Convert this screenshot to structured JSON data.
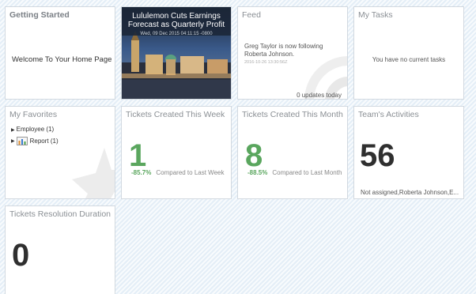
{
  "getting_started": {
    "title": "Getting Started",
    "welcome": "Welcome To Your Home Page"
  },
  "news": {
    "headline": "Lululemon Cuts Earnings Forecast as Quarterly Profit",
    "date": "Wed, 09 Dec 2015 04:11:15 -0800"
  },
  "feed": {
    "title": "Feed",
    "message": "Greg Taylor is now following Roberta Johnson.",
    "timestamp": "2016-10-26 13:30:56Z",
    "updates": "0 updates today"
  },
  "tasks": {
    "title": "My Tasks",
    "empty": "You have no current tasks"
  },
  "favorites": {
    "title": "My Favorites",
    "items": [
      {
        "label": "Employee (1)"
      },
      {
        "label": "Report (1)"
      }
    ]
  },
  "tickets_week": {
    "title": "Tickets Created This Week",
    "value": "1",
    "pct": "-85.7%",
    "cmp": "Compared to Last Week"
  },
  "tickets_month": {
    "title": "Tickets Created This Month",
    "value": "8",
    "pct": "-88.5%",
    "cmp": "Compared to Last Month"
  },
  "team": {
    "title": "Team's Activities",
    "value": "56",
    "note": "Not assigned,Roberta Johnson,E..."
  },
  "resolution": {
    "title": "Tickets Resolution Duration",
    "value": "0"
  },
  "colors": {
    "green": "#5aa65e",
    "tile_border": "#d2d9e0",
    "title_gray": "#8a8f94"
  }
}
